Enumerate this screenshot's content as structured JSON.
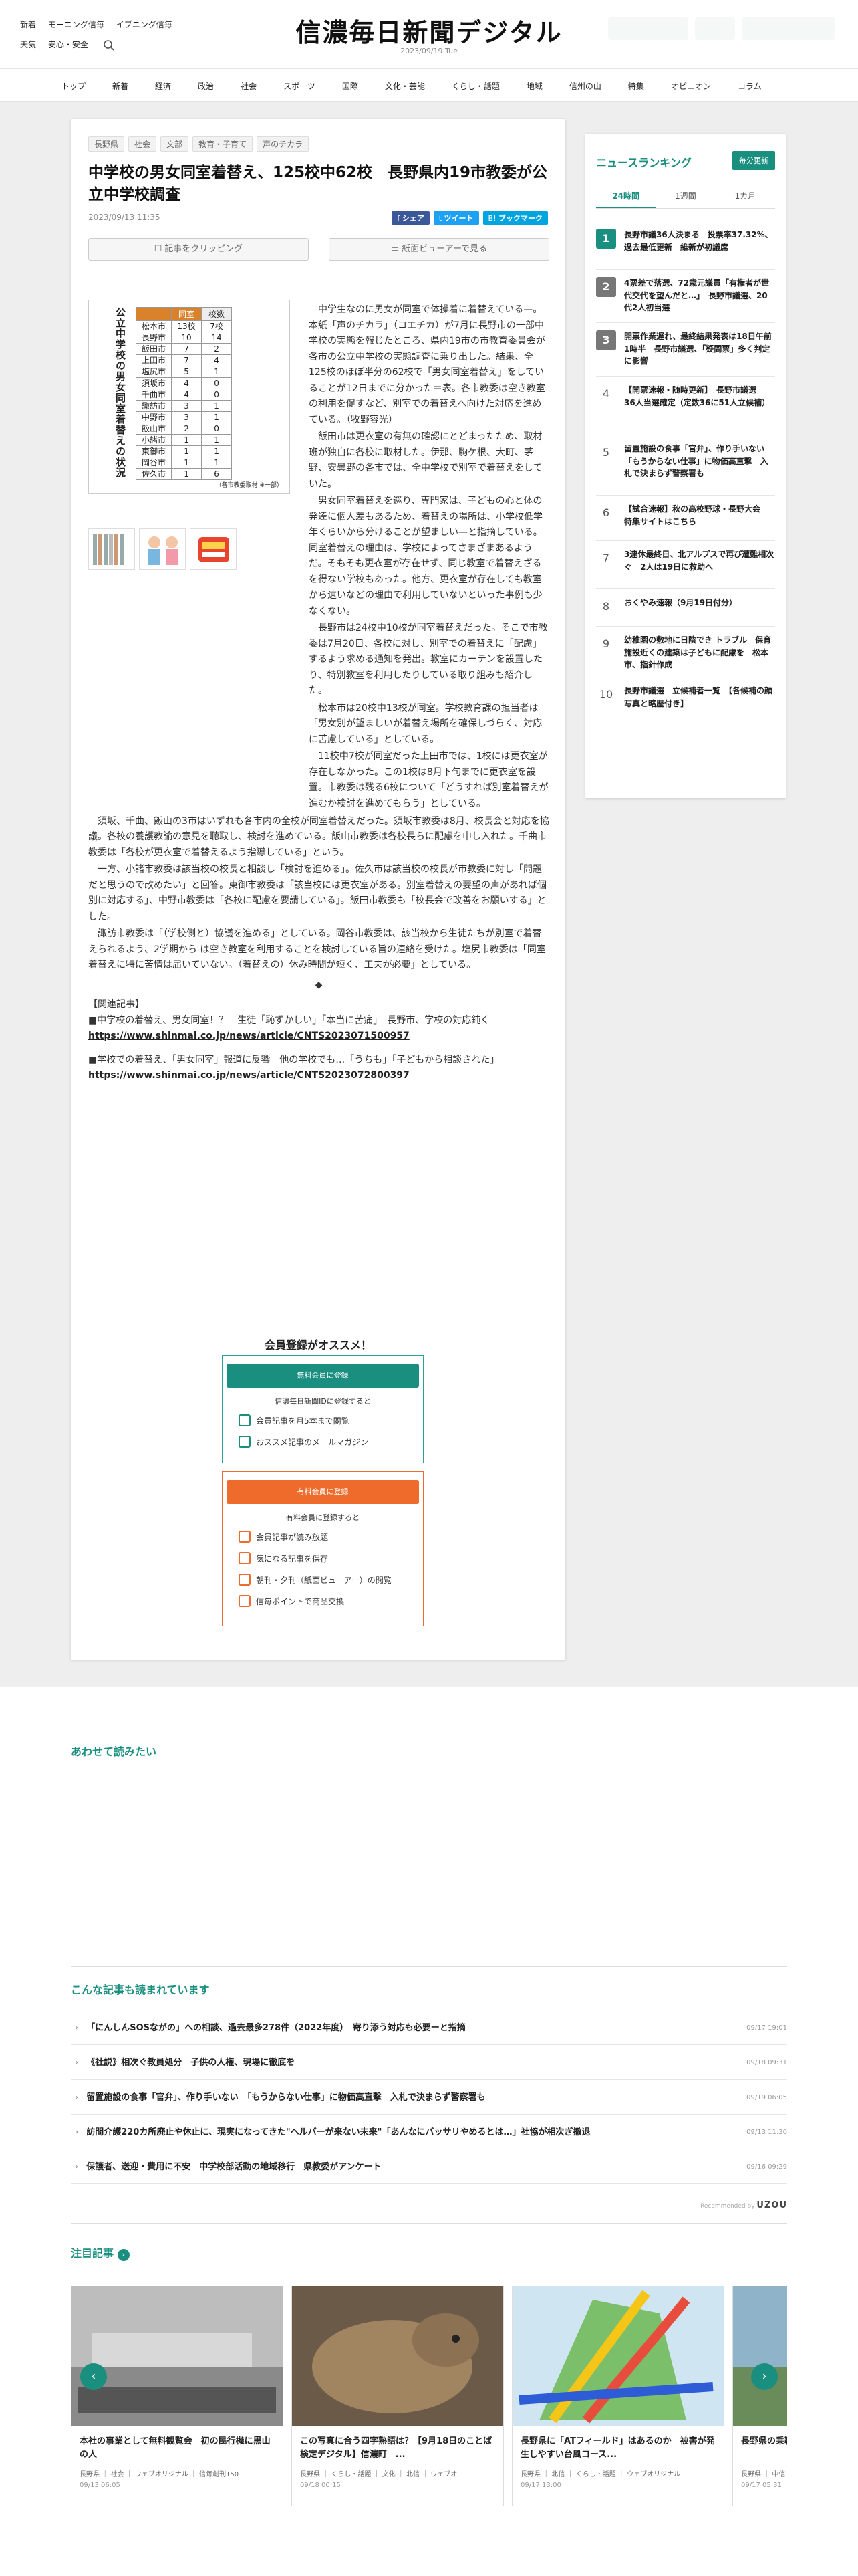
{
  "header": {
    "nav_row1": [
      "新着",
      "モーニング信毎",
      "イブニング信毎"
    ],
    "nav_row2": [
      "天気",
      "安心・安全"
    ],
    "logo": "信濃毎日新聞デジタル",
    "date": "2023/09/19 Tue"
  },
  "catnav": [
    "トップ",
    "新着",
    "経済",
    "政治",
    "社会",
    "スポーツ",
    "国際",
    "文化・芸能",
    "くらし・話題",
    "地域",
    "信州の山",
    "特集",
    "オピニオン",
    "コラム"
  ],
  "article": {
    "tags": [
      "長野県",
      "社会",
      "文部",
      "教育・子育て",
      "声のチカラ"
    ],
    "title": "中学校の男女同室着替え、125校中62校　長野県内19市教委が公立中学校調査",
    "date": "2023/09/13 11:35",
    "share": [
      "シェア",
      "ツイート",
      "ブックマーク"
    ],
    "clip_label": "記事をクリッピング",
    "viewer_label": "紙面ビューアーで見る",
    "figure": {
      "title": "公立中学校の男女同室着替えの状況",
      "col_count": "同室",
      "col_total": "校数",
      "rows": [
        {
          "city": "松本市",
          "same": "13校",
          "total": "7校"
        },
        {
          "city": "長野市",
          "same": "10",
          "total": "14"
        },
        {
          "city": "飯田市",
          "same": "7",
          "total": "2"
        },
        {
          "city": "上田市",
          "same": "7",
          "total": "4"
        },
        {
          "city": "塩尻市",
          "same": "5",
          "total": "1"
        },
        {
          "city": "須坂市",
          "same": "4",
          "total": "0"
        },
        {
          "city": "千曲市",
          "same": "4",
          "total": "0"
        },
        {
          "city": "諏訪市",
          "same": "3",
          "total": "1"
        },
        {
          "city": "中野市",
          "same": "3",
          "total": "1"
        },
        {
          "city": "飯山市",
          "same": "2",
          "total": "0"
        },
        {
          "city": "小諸市",
          "same": "1",
          "total": "1"
        },
        {
          "city": "東御市",
          "same": "1",
          "total": "1"
        },
        {
          "city": "岡谷市",
          "same": "1",
          "total": "1"
        },
        {
          "city": "佐久市",
          "same": "1",
          "total": "6"
        }
      ],
      "note": "（各市教委取材 ※一部）"
    },
    "paragraphs": [
      "中学生なのに男女が同室で体操着に着替えている—。本紙「声のチカラ」（コエチカ）が7月に長野市の一部中学校の実態を報じたところ、県内19市の市教育委員会が各市の公立中学校の実態調査に乗り出した。結果、全125校のほぼ半分の62校で「男女同室着替え」をしていることが12日までに分かった＝表。各市教委は空き教室の利用を促すなど、別室での着替えへ向けた対応を進めている。（牧野容光）",
      "飯田市は更衣室の有無の確認にとどまったため、取材班が独自に各校に取材した。伊那、駒ケ根、大町、茅野、安曇野の各市では、全中学校で別室で着替えをしていた。",
      "男女同室着替えを巡り、専門家は、子どもの心と体の発達に個人差もあるため、着替えの場所は、小学校低学年くらいから分けることが望ましい—と指摘している。同室着替えの理由は、学校によってさまざまあるようだ。そもそも更衣室が存在せず、同じ教室で着替えざるを得ない学校もあった。他方、更衣室が存在しても教室から遠いなどの理由で利用していないといった事例も少なくない。",
      "長野市は24校中10校が同室着替えだった。そこで市教委は7月20日、各校に対し、別室での着替えに「配慮」するよう求める通知を発出。教室にカーテンを設置したり、特別教室を利用したりしている取り組みも紹介した。",
      "松本市は20校中13校が同室。学校教育課の担当者は「男女別が望ましいが着替え場所を確保しづらく、対応に苦慮している」としている。",
      "11校中7校が同室だった上田市では、1校には更衣室が存在しなかった。この1校は8月下旬までに更衣室を設置。市教委は残る6校について「どうすれば別室着替えが進むか検討を進めてもらう」としている。",
      "須坂、千曲、飯山の3市はいずれも各市内の全校が同室着替えだった。須坂市教委は8月、校長会と対応を協議。各校の養護教諭の意見を聴取し、検討を進めている。飯山市教委は各校長らに配慮を申し入れた。千曲市教委は「各校が更衣室で着替えるよう指導している」という。",
      "一方、小諸市教委は該当校の校長と相談し「検討を進める」。佐久市は該当校の校長が市教委に対し「問題だと思うので改めたい」と回答。東御市教委は「該当校には更衣室がある。別室着替えの要望の声があれば個別に対応する」、中野市教委は「各校に配慮を要請している」。飯田市教委も「校長会で改善をお願いする」とした。",
      "諏訪市教委は「（学校側と）協議を進める」としている。岡谷市教委は、該当校から生徒たちが別室で着替えられるよう、2学期から は空き教室を利用することを検討している旨の連絡を受けた。塩尻市教委は「同室着替えに特に苦情は届いていない。（着替えの）休み時間が短く、工夫が必要」としている。"
    ],
    "diamond": "◆",
    "related_heading": "【関連記事】",
    "related": [
      {
        "text": "■中学校の着替え、男女同室！？　生徒「恥ずかしい」「本当に苦痛」　長野市、学校の対応鈍く",
        "url": "https://www.shinmai.co.jp/news/article/CNTS2023071500957"
      },
      {
        "text": "■学校での着替え、「男女同室」報道に反響　他の学校でも…「うちも」「子どもから相談された」",
        "url": "https://www.shinmai.co.jp/news/article/CNTS2023072800397"
      }
    ],
    "membership": {
      "title": "会員登録がオススメ！",
      "free_button": "無料会員に登録",
      "free_desc": "信濃毎日新聞IDに登録すると",
      "free_benefits": [
        "会員記事を月5本まで閲覧",
        "おススメ記事のメールマガジン"
      ],
      "paid_button": "有料会員に登録",
      "paid_desc": "有料会員に登録すると",
      "paid_benefits": [
        "会員記事が読み放題",
        "気になる記事を保存",
        "朝刊・夕刊（紙面ビューアー）の閲覧",
        "信毎ポイントで商品交換"
      ]
    }
  },
  "ranking": {
    "title": "ニュースランキング",
    "update": "毎分更新",
    "tabs": [
      "24時間",
      "1週間",
      "1カ月"
    ],
    "active_tab": "24時間",
    "items": [
      {
        "rank": "1",
        "text": "長野市議36人決まる　投票率37.32%、過去最低更新　維新が初議席"
      },
      {
        "rank": "2",
        "text": "4票差で落選、72歳元議員「有権者が世代交代を望んだと…」　長野市議選、20代2人初当選"
      },
      {
        "rank": "3",
        "text": "開票作業遅れ、最終結果発表は18日午前1時半　長野市議選、「疑問票」多く判定に影響"
      },
      {
        "rank": "4",
        "text": "【開票速報・随時更新】　長野市議選　36人当選確定（定数36に51人立候補）"
      },
      {
        "rank": "5",
        "text": "留置施設の食事「官弁」、作り手いない　「もうからない仕事」に物価高直撃　入札で決まらず警察署も"
      },
      {
        "rank": "6",
        "text": "【試合速報】秋の高校野球・長野大会　特集サイトはこちら"
      },
      {
        "rank": "7",
        "text": "3連休最終日、北アルプスで再び遭難相次ぐ　2人は19日に救助へ"
      },
      {
        "rank": "8",
        "text": "おくやみ速報（9月19日付分）"
      },
      {
        "rank": "9",
        "text": "幼稚園の敷地に日陰でき トラブル　保育施設近くの建築は子どもに配慮を　松本市、指針作成"
      },
      {
        "rank": "10",
        "text": "長野市議選　立候補者一覧　【各候補の顔写真と略歴付き】"
      }
    ]
  },
  "lower": {
    "also_read_title": "あわせて読みたい",
    "recommend_title": "こんな記事も読まれています",
    "recommend_items": [
      {
        "text": "「にんしんSOSながの」への相談、過去最多278件（2022年度）　寄り添う対応も必要ーと指摘",
        "date": "09/17 19:01"
      },
      {
        "text": "《社説》相次ぐ教員処分　子供の人権、現場に徹底を",
        "date": "09/18 09:31"
      },
      {
        "text": "留置施設の食事「官弁」、作り手いない　「もうからない仕事」に物価高直撃　入札で決まらず警察署も",
        "date": "09/19 06:05"
      },
      {
        "text": "訪問介護220カ所廃止や休止に、現実になってきた\"ヘルパーが来ない未来\"「あんなにバッサリやめるとは…」社協が相次ぎ撤退",
        "date": "09/13 11:30"
      },
      {
        "text": "保護者、送迎・費用に不安　中学校部活動の地域移行　県教委がアンケート",
        "date": "09/16 09:29"
      }
    ],
    "credit_label": "Recommended by",
    "credit_brand": "UZOU",
    "featured_title": "注目記事",
    "cards": [
      {
        "title": "本社の事業として無料観覧会　初の民行機に黒山の人",
        "meta": "長野県 ｜ 社会 ｜ ウェブオリジナル ｜ 信毎創刊150",
        "date": "09/13 06:05"
      },
      {
        "title": "この写真に合う四字熟語は？【9月18日のことば検定デジタル】信濃町　...",
        "meta": "長野県 ｜ くらし・話題 ｜ 文化 ｜ 北信 ｜ ウェブオ",
        "date": "09/18 00:15"
      },
      {
        "title": "長野県に「ATフィールド」はあるのか　被害が発生しやすい台風コース...",
        "meta": "長野県 ｜ 北信 ｜ くらし・話題 ｜ ウェブオリジナル",
        "date": "09/17 13:00"
      },
      {
        "title": "長野県の乗鞍高原...　川沿いの小学校",
        "meta": "長野県 ｜ 中信",
        "date": "09/17 05:31"
      }
    ]
  },
  "colors": {
    "accent": "#1a8f80",
    "paid": "#ee6b2c",
    "facebook": "#3b5998",
    "twitter": "#1da1f2",
    "hatena": "#00a4de"
  }
}
